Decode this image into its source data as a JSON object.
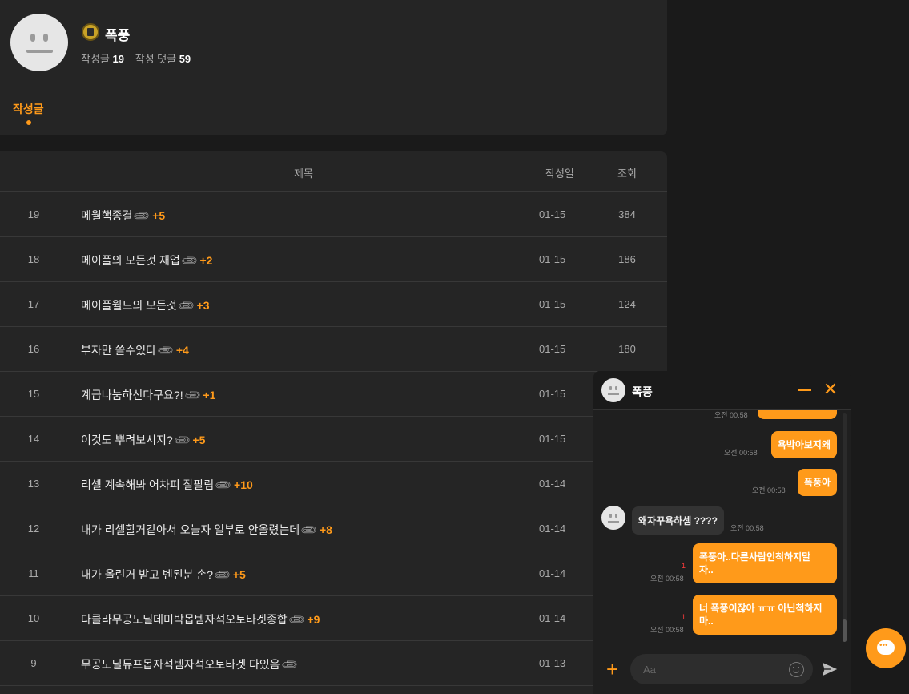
{
  "profile": {
    "nickname": "폭풍",
    "posts_label": "작성글",
    "posts_count": "19",
    "comments_label": "작성 댓글",
    "comments_count": "59",
    "active_tab": "작성글"
  },
  "table": {
    "headers": {
      "title": "제목",
      "date": "작성일",
      "views": "조회"
    },
    "rows": [
      {
        "num": "19",
        "title": "메월핵종결",
        "comments": "+5",
        "date": "01-15",
        "views": "384"
      },
      {
        "num": "18",
        "title": "메이플의 모든것 재업",
        "comments": "+2",
        "date": "01-15",
        "views": "186"
      },
      {
        "num": "17",
        "title": "메이플월드의 모든것",
        "comments": "+3",
        "date": "01-15",
        "views": "124"
      },
      {
        "num": "16",
        "title": "부자만 쓸수있다",
        "comments": "+4",
        "date": "01-15",
        "views": "180"
      },
      {
        "num": "15",
        "title": "계급나눔하신다구요?!",
        "comments": "+1",
        "date": "01-15",
        "views": ""
      },
      {
        "num": "14",
        "title": "이것도 뿌려보시지?",
        "comments": "+5",
        "date": "01-15",
        "views": ""
      },
      {
        "num": "13",
        "title": "리셀 계속해봐 어차피 잘팔림",
        "comments": "+10",
        "date": "01-14",
        "views": ""
      },
      {
        "num": "12",
        "title": "내가 리셀할거같아서 오늘자 일부로 안올렸는데",
        "comments": "+8",
        "date": "01-14",
        "views": ""
      },
      {
        "num": "11",
        "title": "내가 올린거 받고 벤된분 손?",
        "comments": "+5",
        "date": "01-14",
        "views": ""
      },
      {
        "num": "10",
        "title": "다클라무공노딜데미박몹템자석오토타겟종합",
        "comments": "+9",
        "date": "01-14",
        "views": ""
      },
      {
        "num": "9",
        "title": "무공노딜듀프몹자석템자석오토타겟 다있음",
        "comments": "",
        "date": "01-13",
        "views": ""
      }
    ]
  },
  "chat": {
    "name": "폭풍",
    "messages": {
      "m0_time": "오전 00:58",
      "m1_text": "욕박아보지왜",
      "m1_time": "오전 00:58",
      "m2_text": "폭풍아",
      "m2_time": "오전 00:58",
      "m3_text": "왜자꾸욕하셈 ????",
      "m3_time": "오전 00:58",
      "m4_line1": "폭풍아..다른사람인척하지말",
      "m4_line2": "자..",
      "m4_time": "오전 00:58",
      "m4_unread": "1",
      "m5_line1": "너 폭풍이잖아 ㅠㅠ 아닌척하지",
      "m5_line2": "마..",
      "m5_time": "오전 00:58",
      "m5_unread": "1"
    },
    "input_placeholder": "Aa"
  },
  "colors": {
    "accent": "#ff9a1a",
    "card": "#252525",
    "unread": "#ff3b3b"
  }
}
